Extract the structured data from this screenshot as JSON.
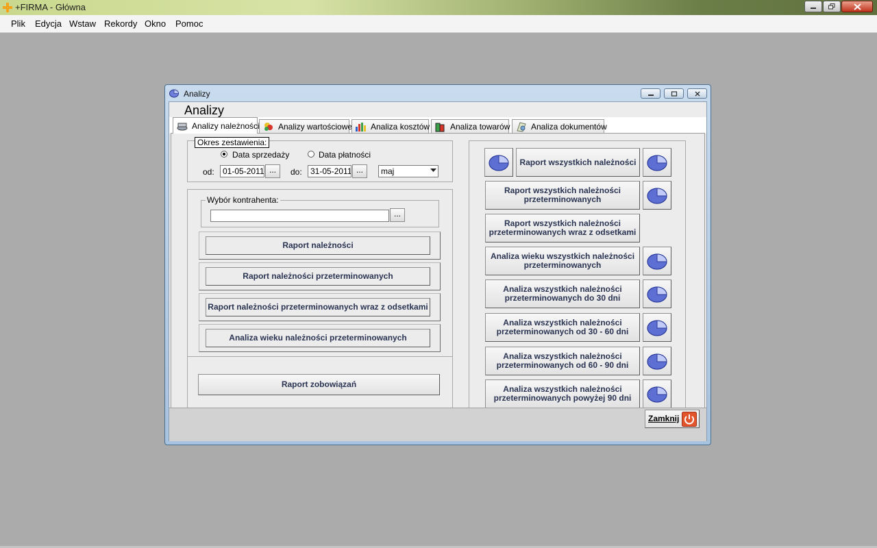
{
  "app": {
    "title": "+FIRMA - Główna"
  },
  "menu": [
    {
      "label": "Plik"
    },
    {
      "label": "Edycja"
    },
    {
      "label": "Wstaw"
    },
    {
      "label": "Rekordy"
    },
    {
      "label": "Okno"
    },
    {
      "label": "Pomoc"
    }
  ],
  "window": {
    "title": "Analizy",
    "header": "Analizy"
  },
  "tabs": [
    {
      "label": "Analizy należności",
      "icon": "receivables-icon",
      "active": true
    },
    {
      "label": "Analizy wartościowe",
      "icon": "values-icon",
      "active": false
    },
    {
      "label": "Analiza kosztów",
      "icon": "bar-chart-icon",
      "active": false
    },
    {
      "label": "Analiza towarów",
      "icon": "goods-icon",
      "active": false
    },
    {
      "label": "Analiza dokumentów",
      "icon": "documents-icon",
      "active": false
    }
  ],
  "period": {
    "legend": "Okres zestawienia:",
    "radio_sale": "Data sprzedaży",
    "radio_payment": "Data płatności",
    "selected": "Data sprzedaży",
    "from_label": "od:",
    "from_value": "01-05-2011",
    "to_label": "do:",
    "to_value": "31-05-2011",
    "dots": "...",
    "month": "maj"
  },
  "contractor": {
    "legend": "Wybór kontrahenta:",
    "value": "",
    "dots": "..."
  },
  "left_buttons": [
    {
      "label": "Raport należności"
    },
    {
      "label": "Raport należności przeterminowanych"
    },
    {
      "label": "Raport należności przeterminowanych wraz z odsetkami"
    },
    {
      "label": "Analiza wieku należności przeterminowanych"
    }
  ],
  "liabilities_button": "Raport zobowiązań",
  "right_buttons": [
    {
      "label": "Raport wszystkich należności",
      "left_pie": true,
      "right_pie": true
    },
    {
      "label": "Raport wszystkich należności przeterminowanych",
      "left_pie": false,
      "right_pie": true
    },
    {
      "label": "Raport wszystkich należności przeterminowanych wraz z odsetkami",
      "left_pie": false,
      "right_pie": false
    },
    {
      "label": "Analiza wieku wszystkich należności przeterminowanych",
      "left_pie": false,
      "right_pie": true
    },
    {
      "label": "Analiza wszystkich należności przeterminowanych do 30 dni",
      "left_pie": false,
      "right_pie": true
    },
    {
      "label": "Analiza wszystkich należności przeterminowanych od 30 - 60 dni",
      "left_pie": false,
      "right_pie": true
    },
    {
      "label": "Analiza wszystkich należności przeterminowanych od 60 - 90 dni",
      "left_pie": false,
      "right_pie": true
    },
    {
      "label": "Analiza wszystkich należności przeterminowanych powyżej 90 dni",
      "left_pie": false,
      "right_pie": true
    }
  ],
  "close_button": "Zamknij",
  "colors": {
    "desktop": "#ababab",
    "button_text": "#2a3452",
    "pie": "#5e6fd4",
    "close_icon": "#e2542a"
  }
}
